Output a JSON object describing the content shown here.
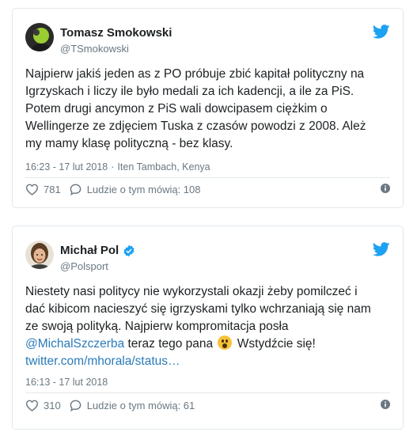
{
  "tweets": [
    {
      "name": "Tomasz Smokowski",
      "handle": "@TSmokowski",
      "lines": [
        "Najpierw jakiś jeden as z PO próbuje zbić kapitał polityczny na",
        "Igrzyskach i liczy ile było medali za ich kadencji, a ile za PiS.",
        "Potem drugi ancymon z PiS wali dowcipasem ciężkim o",
        "Wellingerze ze zdjęciem Tuska z czasów powodzi z 2008. Ależ",
        "my mamy klasę polityczną - bez klasy."
      ],
      "time": "16:23 - 17 lut 2018",
      "separator": "·",
      "location": "Iten Tambach, Kenya",
      "likes": "781",
      "talk": "Ludzie o tym mówią: 108"
    },
    {
      "name": "Michał Pol",
      "handle": "@Polsport",
      "verified": true,
      "lines": [
        "Niestety nasi politycy nie wykorzystali okazji żeby pomilczeć i",
        "dać kibicom nacieszyć się igrzyskami tylko wchrzaniają się nam",
        "ze swoją polityką. Najpierw kompromitacja posła"
      ],
      "mention": "@MichalSzczerba",
      "after_mention": " teraz tego pana ",
      "emoji_name": "astonished-face-emoji",
      "after_emoji": " Wstydźcie się!",
      "link": "twitter.com/mhorala/status…",
      "time": "16:13 - 17 lut 2018",
      "likes": "310",
      "talk": "Ludzie o tym mówią: 61"
    }
  ],
  "colors": {
    "twitter_blue": "#1da1f2",
    "link": "#2b7bb9",
    "meta": "#697882",
    "border": "#e1e8ed"
  }
}
